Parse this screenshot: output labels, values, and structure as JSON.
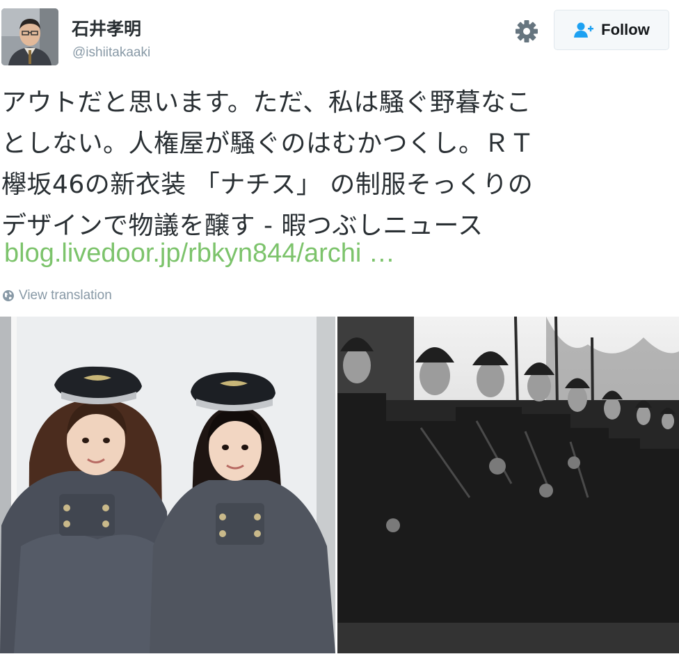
{
  "user": {
    "display_name": "石井孝明",
    "screen_name": "@ishiitakaaki",
    "avatar_icon": "user-avatar"
  },
  "actions": {
    "settings_icon": "gear-icon",
    "follow_icon": "add-user-icon",
    "follow_label": "Follow"
  },
  "tweet": {
    "lines": [
      "アウトだと思います。ただ、私は騒ぐ野暮なこ",
      "としない。人権屋が騒ぐのはむかつくし。ＲＴ",
      "欅坂46の新衣装 「ナチス」 の制服そっくりの",
      "デザインで物議を醸す - 暇つぶしニュース"
    ],
    "link": "blog.livedoor.jp/rbkyn844/archi …"
  },
  "translate": {
    "icon": "globe-icon",
    "label": "View translation"
  },
  "media": {
    "left_photo": "two-women-in-grey-capes-and-peaked-caps",
    "right_photo": "black-and-white-soldiers-in-helmets-row"
  },
  "colors": {
    "link": "#7cc36b",
    "meta_text": "#8899a6",
    "body_text": "#292f33",
    "button_border": "#e1e8ed",
    "follow_icon": "#1da1f2"
  }
}
